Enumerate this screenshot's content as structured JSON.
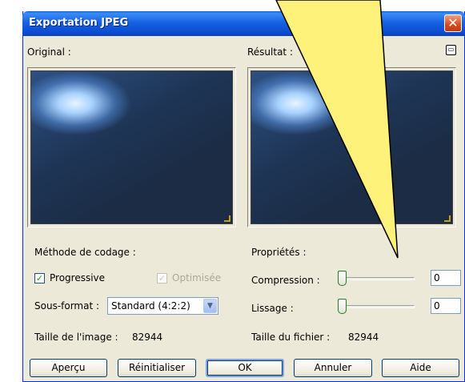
{
  "window": {
    "title": "Exportation JPEG",
    "close_glyph": "✕"
  },
  "previews": {
    "original_label": "Original :",
    "result_label": "Résultat :"
  },
  "encoding": {
    "heading": "Méthode de codage :",
    "progressive_label": "Progressive",
    "progressive_checked": true,
    "optimized_label": "Optimisée",
    "optimized_checked": true,
    "optimized_enabled": false,
    "subformat_label": "Sous-format :",
    "subformat_value": "Standard (4:2:2)",
    "image_size_label": "Taille de l'image :",
    "image_size_value": "82944"
  },
  "properties": {
    "heading": "Propriétés :",
    "compression_label": "Compression :",
    "compression_value": "0",
    "smoothing_label": "Lissage :",
    "smoothing_value": "0",
    "file_size_label": "Taille du fichier :",
    "file_size_value": "82944"
  },
  "buttons": {
    "preview": "Aperçu",
    "reset": "Réinitialiser",
    "ok": "OK",
    "cancel": "Annuler",
    "help": "Aide"
  },
  "colors": {
    "title_bar": "#0a5fe8",
    "dialog_bg": "#ece9d8",
    "callout_fill": "#fff27a",
    "checkmark": "#21a121"
  },
  "icons": {
    "fullscreen": "fullscreen-preview-icon",
    "close": "close-icon",
    "dropdown": "chevron-down-icon"
  }
}
